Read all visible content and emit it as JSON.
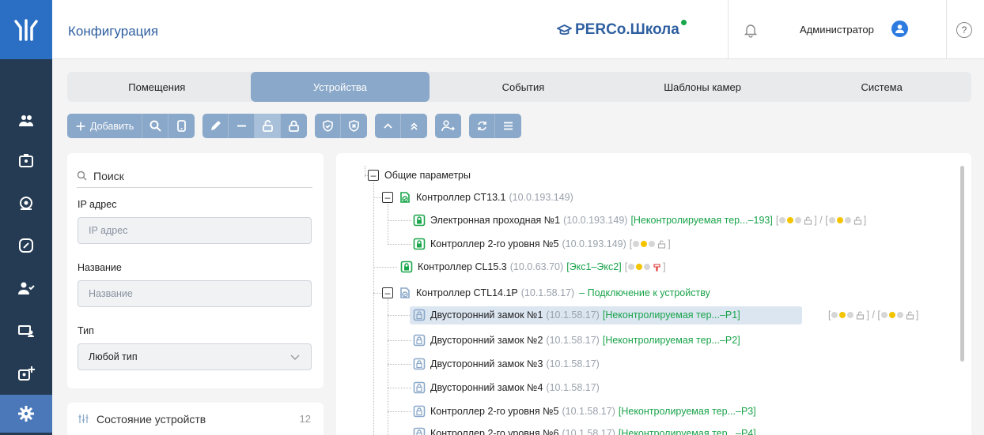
{
  "header": {
    "title": "Конфигурация",
    "brand": "PERCo.Школа",
    "user": "Администратор",
    "help": "?"
  },
  "tabs": [
    {
      "label": "Помещения",
      "active": false
    },
    {
      "label": "Устройства",
      "active": true
    },
    {
      "label": "События",
      "active": false
    },
    {
      "label": "Шаблоны камер",
      "active": false
    },
    {
      "label": "Система",
      "active": false
    }
  ],
  "toolbar": {
    "add_label": "Добавить"
  },
  "filter": {
    "search_label": "Поиск",
    "ip_label": "IP адрес",
    "ip_placeholder": "IP адрес",
    "name_label": "Название",
    "name_placeholder": "Название",
    "type_label": "Тип",
    "type_value": "Любой тип"
  },
  "state_panel": {
    "label": "Состояние устройств",
    "count": "12"
  },
  "tree": {
    "root": "Общие параметры",
    "ct13": {
      "name": "Контроллер CT13.1",
      "ip": "(10.0.193.149)"
    },
    "ep1": {
      "name": "Электронная проходная №1",
      "ip": "(10.0.193.149)",
      "zone": "[Неконтролируемая тер...–193]",
      "status": "[ ] / [ ]"
    },
    "c2_5a": {
      "name": "Контроллер 2-го уровня №5",
      "ip": "(10.0.193.149)"
    },
    "cl15": {
      "name": "Контроллер CL15.3",
      "ip": "(10.0.63.70)",
      "zone": "[Экс1–Экс2]"
    },
    "ctl14": {
      "name": "Контроллер CTL14.1P",
      "ip": "(10.1.58.17)",
      "connect": "– Подключение к устройству"
    },
    "lock1": {
      "name": "Двусторонний замок №1",
      "ip": "(10.1.58.17)",
      "zone": "[Неконтролируемая тер...–P1]"
    },
    "lock2": {
      "name": "Двусторонний замок №2",
      "ip": "(10.1.58.17)",
      "zone": "[Неконтролируемая тер...–P2]"
    },
    "lock3": {
      "name": "Двусторонний замок №3",
      "ip": "(10.1.58.17)"
    },
    "lock4": {
      "name": "Двусторонний замок №4",
      "ip": "(10.1.58.17)"
    },
    "c2_5b": {
      "name": "Контроллер 2-го уровня №5",
      "ip": "(10.1.58.17)",
      "zone": "[Неконтролируемая тер...–P3]"
    },
    "c2_6": {
      "name": "Контроллер 2-го уровня №6",
      "ip": "(10.1.58.17)",
      "zone": "[Неконтролируемая тер...–P4]"
    }
  }
}
